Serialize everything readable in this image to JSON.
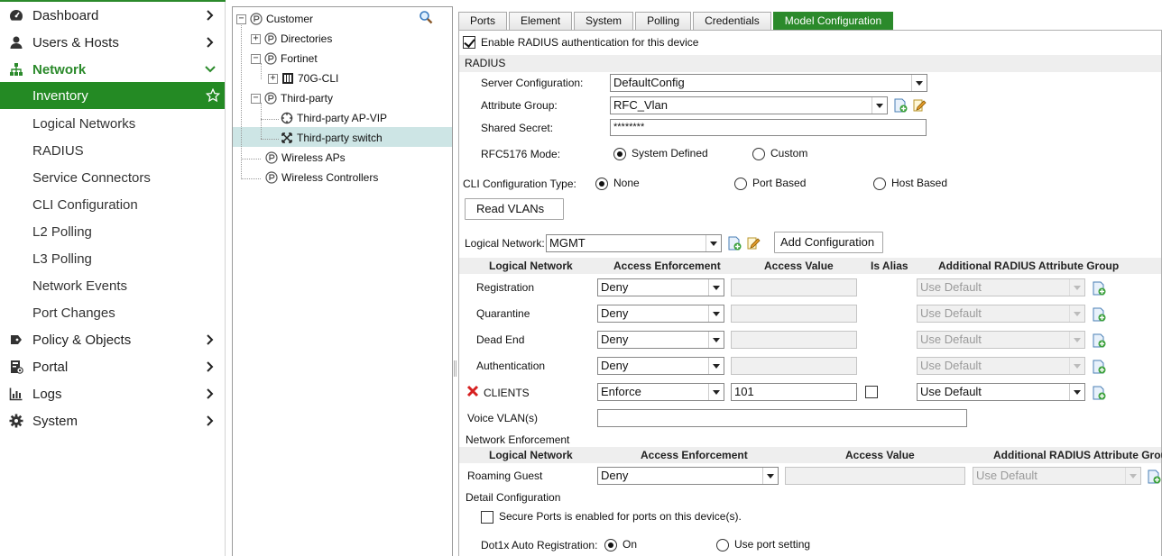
{
  "nav": {
    "items": [
      {
        "label": "Dashboard",
        "icon": "dashboard-icon"
      },
      {
        "label": "Users & Hosts",
        "icon": "user-icon"
      },
      {
        "label": "Network",
        "icon": "network-icon"
      },
      {
        "label": "Inventory"
      },
      {
        "label": "Logical Networks"
      },
      {
        "label": "RADIUS"
      },
      {
        "label": "Service Connectors"
      },
      {
        "label": "CLI Configuration"
      },
      {
        "label": "L2 Polling"
      },
      {
        "label": "L3 Polling"
      },
      {
        "label": "Network Events"
      },
      {
        "label": "Port Changes"
      },
      {
        "label": "Policy & Objects",
        "icon": "policy-icon"
      },
      {
        "label": "Portal",
        "icon": "portal-icon"
      },
      {
        "label": "Logs",
        "icon": "logs-icon"
      },
      {
        "label": "System",
        "icon": "gear-icon"
      }
    ],
    "accent": "#2b8a2b"
  },
  "tree": {
    "root": "Customer",
    "directories": "Directories",
    "fortinet": "Fortinet",
    "device_70g": "70G-CLI",
    "third_party": "Third-party",
    "ap_vip": "Third-party AP-VIP",
    "switch": "Third-party switch",
    "wireless_aps": "Wireless APs",
    "wireless_controllers": "Wireless Controllers"
  },
  "tabs": [
    "Ports",
    "Element",
    "System",
    "Polling",
    "Credentials",
    "Model Configuration"
  ],
  "form": {
    "enable_radius": "Enable RADIUS authentication for this device",
    "radius_section": "RADIUS",
    "server_config_label": "Server Configuration:",
    "server_config_value": "DefaultConfig",
    "attr_group_label": "Attribute Group:",
    "attr_group_value": "RFC_Vlan",
    "shared_secret_label": "Shared Secret:",
    "shared_secret_value": "********",
    "rfc_mode_label": "RFC5176 Mode:",
    "rfc_system": "System Defined",
    "rfc_custom": "Custom",
    "cli_type_label": "CLI Configuration Type:",
    "cli_none": "None",
    "cli_port": "Port Based",
    "cli_host": "Host Based",
    "read_vlans": "Read VLANs",
    "logical_network_label": "Logical Network:",
    "logical_network_value": "MGMT",
    "add_config": "Add Configuration"
  },
  "table1": {
    "headers": [
      "Logical Network",
      "Access Enforcement",
      "Access Value",
      "Is Alias",
      "Additional RADIUS Attribute Group"
    ],
    "rows": [
      {
        "name": "Registration",
        "enforcement": "Deny",
        "value": "",
        "attr": "Use Default"
      },
      {
        "name": "Quarantine",
        "enforcement": "Deny",
        "value": "",
        "attr": "Use Default"
      },
      {
        "name": "Dead End",
        "enforcement": "Deny",
        "value": "",
        "attr": "Use Default"
      },
      {
        "name": "Authentication",
        "enforcement": "Deny",
        "value": "",
        "attr": "Use Default"
      },
      {
        "name": "CLIENTS",
        "enforcement": "Enforce",
        "value": "101",
        "attr": "Use Default"
      }
    ],
    "voice_label": "Voice VLAN(s)",
    "voice_value": ""
  },
  "network_enforcement": {
    "title": "Network Enforcement",
    "headers": [
      "Logical Network",
      "Access Enforcement",
      "Access Value",
      "Additional RADIUS Attribute Group"
    ],
    "row": {
      "name": "Roaming Guest",
      "enforcement": "Deny",
      "value": "",
      "attr": "Use Default"
    }
  },
  "detail": {
    "title": "Detail Configuration",
    "secure_ports": "Secure Ports is enabled for ports on this device(s).",
    "dot1x_label": "Dot1x Auto Registration:",
    "dot1x_on": "On",
    "dot1x_port": "Use port setting"
  }
}
